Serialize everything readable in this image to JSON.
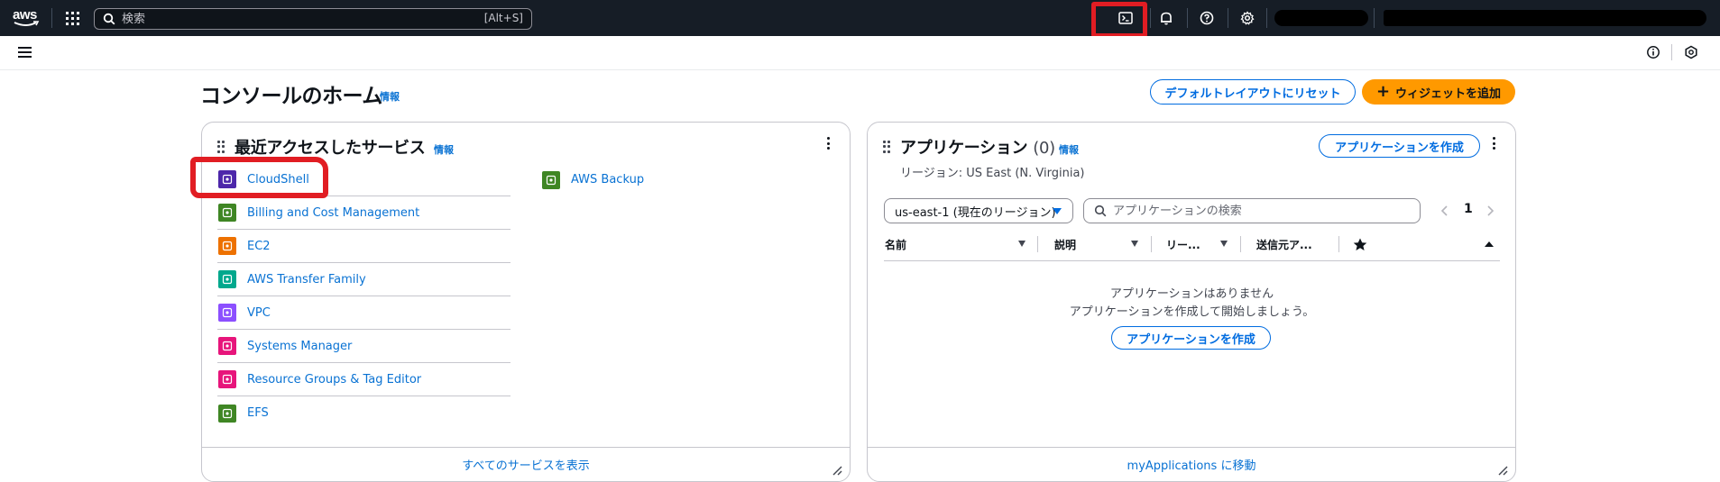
{
  "topbar": {
    "logo_text": "aws",
    "search_placeholder": "検索",
    "search_shortcut": "[Alt+S]"
  },
  "page": {
    "title": "コンソールのホーム",
    "info": "情報",
    "reset_button": "デフォルトレイアウトにリセット",
    "add_widget_button": "ウィジェットを追加"
  },
  "recent": {
    "title": "最近アクセスしたサービス",
    "info": "情報",
    "services_left": [
      {
        "name": "CloudShell",
        "color": "#4d27aa"
      },
      {
        "name": "Billing and Cost Management",
        "color": "#3f8624"
      },
      {
        "name": "EC2",
        "color": "#ed7100"
      },
      {
        "name": "AWS Transfer Family",
        "color": "#01a88d"
      },
      {
        "name": "VPC",
        "color": "#8c4fff"
      },
      {
        "name": "Systems Manager",
        "color": "#e7157b"
      },
      {
        "name": "Resource Groups & Tag Editor",
        "color": "#e7157b"
      },
      {
        "name": "EFS",
        "color": "#3f8624"
      }
    ],
    "services_right": [
      {
        "name": "AWS Backup",
        "color": "#3f8624"
      }
    ],
    "footer_link": "すべてのサービスを表示"
  },
  "apps": {
    "title": "アプリケーション",
    "count": "(0)",
    "info": "情報",
    "create_button": "アプリケーションを作成",
    "region": "リージョン: US East (N. Virginia)",
    "region_select": "us-east-1 (現在のリージョン)",
    "search_placeholder": "アプリケーションの検索",
    "page_number": "1",
    "columns": [
      "名前",
      "説明",
      "リー...",
      "送信元ア..."
    ],
    "empty_title": "アプリケーションはありません",
    "empty_desc": "アプリケーションを作成して開始しましょう。",
    "empty_create_button": "アプリケーションを作成",
    "footer_link": "myApplications に移動"
  },
  "colors": {
    "topbar": "#161d26",
    "link": "#0972d3",
    "accent": "#ff9900",
    "highlight": "#e11d23"
  }
}
